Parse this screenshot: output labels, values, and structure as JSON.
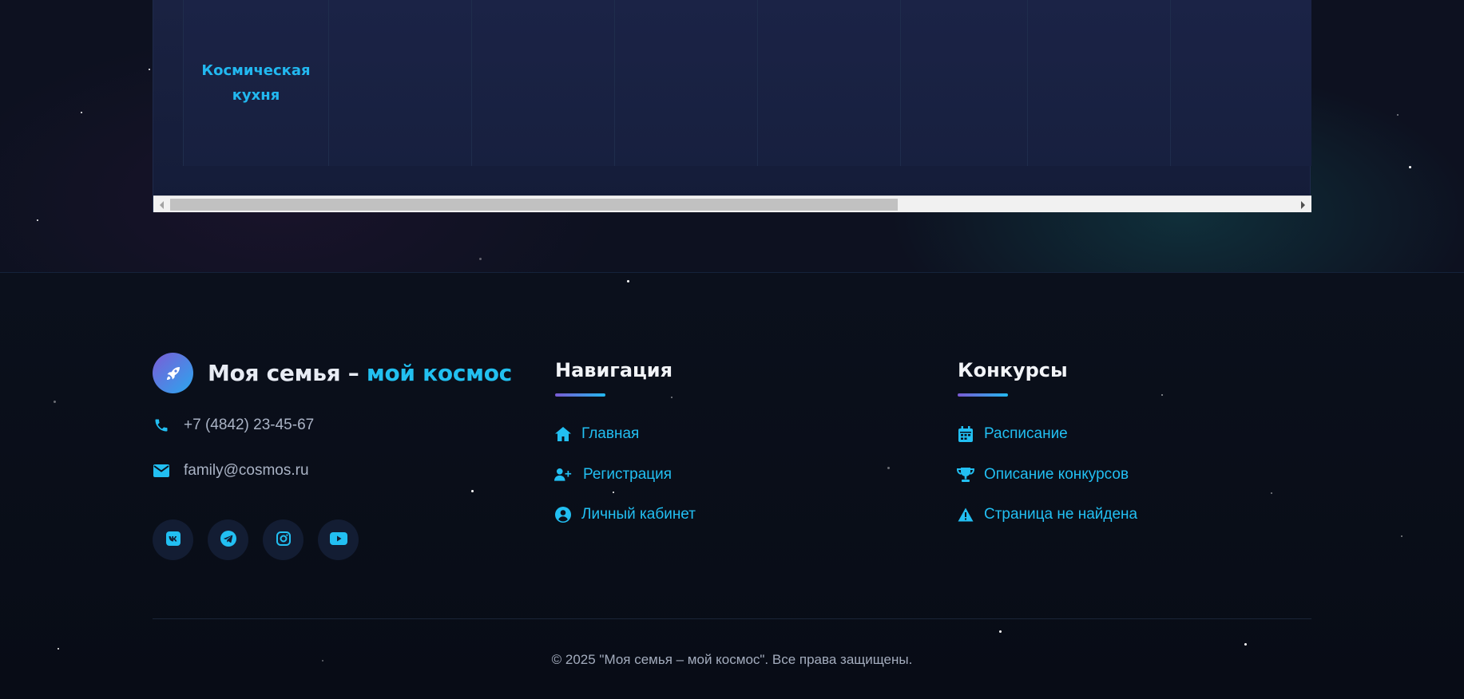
{
  "schedule_table": {
    "first_cell_label": "Космическая кухня"
  },
  "footer": {
    "brand": {
      "title_main": "Моя семья – ",
      "title_accent": "мой космос",
      "logo_icon": "rocket-icon"
    },
    "contacts": {
      "phone": "+7 (4842) 23-45-67",
      "email": "family@cosmos.ru"
    },
    "socials": [
      {
        "name": "VK",
        "icon": "vk-icon"
      },
      {
        "name": "Telegram",
        "icon": "telegram-icon"
      },
      {
        "name": "Instagram",
        "icon": "instagram-icon"
      },
      {
        "name": "YouTube",
        "icon": "youtube-icon"
      }
    ],
    "navigation": {
      "heading": "Навигация",
      "links": [
        {
          "label": "Главная",
          "icon": "home-icon"
        },
        {
          "label": "Регистрация",
          "icon": "user-plus-icon"
        },
        {
          "label": "Личный кабинет",
          "icon": "user-circle-icon"
        }
      ]
    },
    "contests": {
      "heading": "Конкурсы",
      "links": [
        {
          "label": "Расписание",
          "icon": "calendar-icon"
        },
        {
          "label": "Описание конкурсов",
          "icon": "trophy-icon"
        },
        {
          "label": "Страница не найдена",
          "icon": "warning-icon"
        }
      ]
    },
    "copyright": "© 2025 \"Моя семья – мой космос\". Все права защищены."
  },
  "colors": {
    "accent": "#22bff2",
    "gradient_start": "#7a5ad4",
    "background": "#0a0e1a"
  }
}
